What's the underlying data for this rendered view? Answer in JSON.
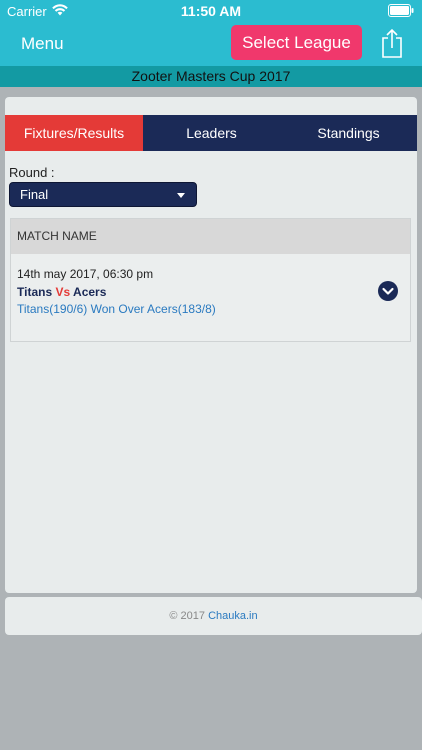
{
  "status_bar": {
    "carrier": "Carrier",
    "time": "11:50 AM",
    "icons": [
      "wifi-icon",
      "battery-icon"
    ]
  },
  "nav": {
    "menu_label": "Menu",
    "league_button": "Select League",
    "share_icon": "share-icon",
    "background": "#2bbcd0",
    "accent": "#f0386c"
  },
  "league_title": "Zooter Masters Cup 2017",
  "tabs": [
    {
      "label": "Fixtures/Results",
      "active": true
    },
    {
      "label": "Leaders",
      "active": false
    },
    {
      "label": "Standings",
      "active": false
    }
  ],
  "round": {
    "label": "Round :",
    "selected": "Final"
  },
  "table": {
    "header": "MATCH NAME",
    "rows": [
      {
        "date": "14th may 2017, 06:30 pm",
        "team_a": "Titans",
        "vs": "Vs",
        "team_b": "Acers",
        "result": "Titans(190/6) Won Over Acers(183/8)",
        "toggle_icon": "chevron-down-icon"
      }
    ]
  },
  "footer": {
    "copyright": "© 2017",
    "link": "Chauka.in"
  },
  "colors": {
    "tab_active": "#e43a37",
    "tab_bar": "#1b2a57",
    "league_bar": "#139aa3",
    "link": "#2a7ac0"
  }
}
